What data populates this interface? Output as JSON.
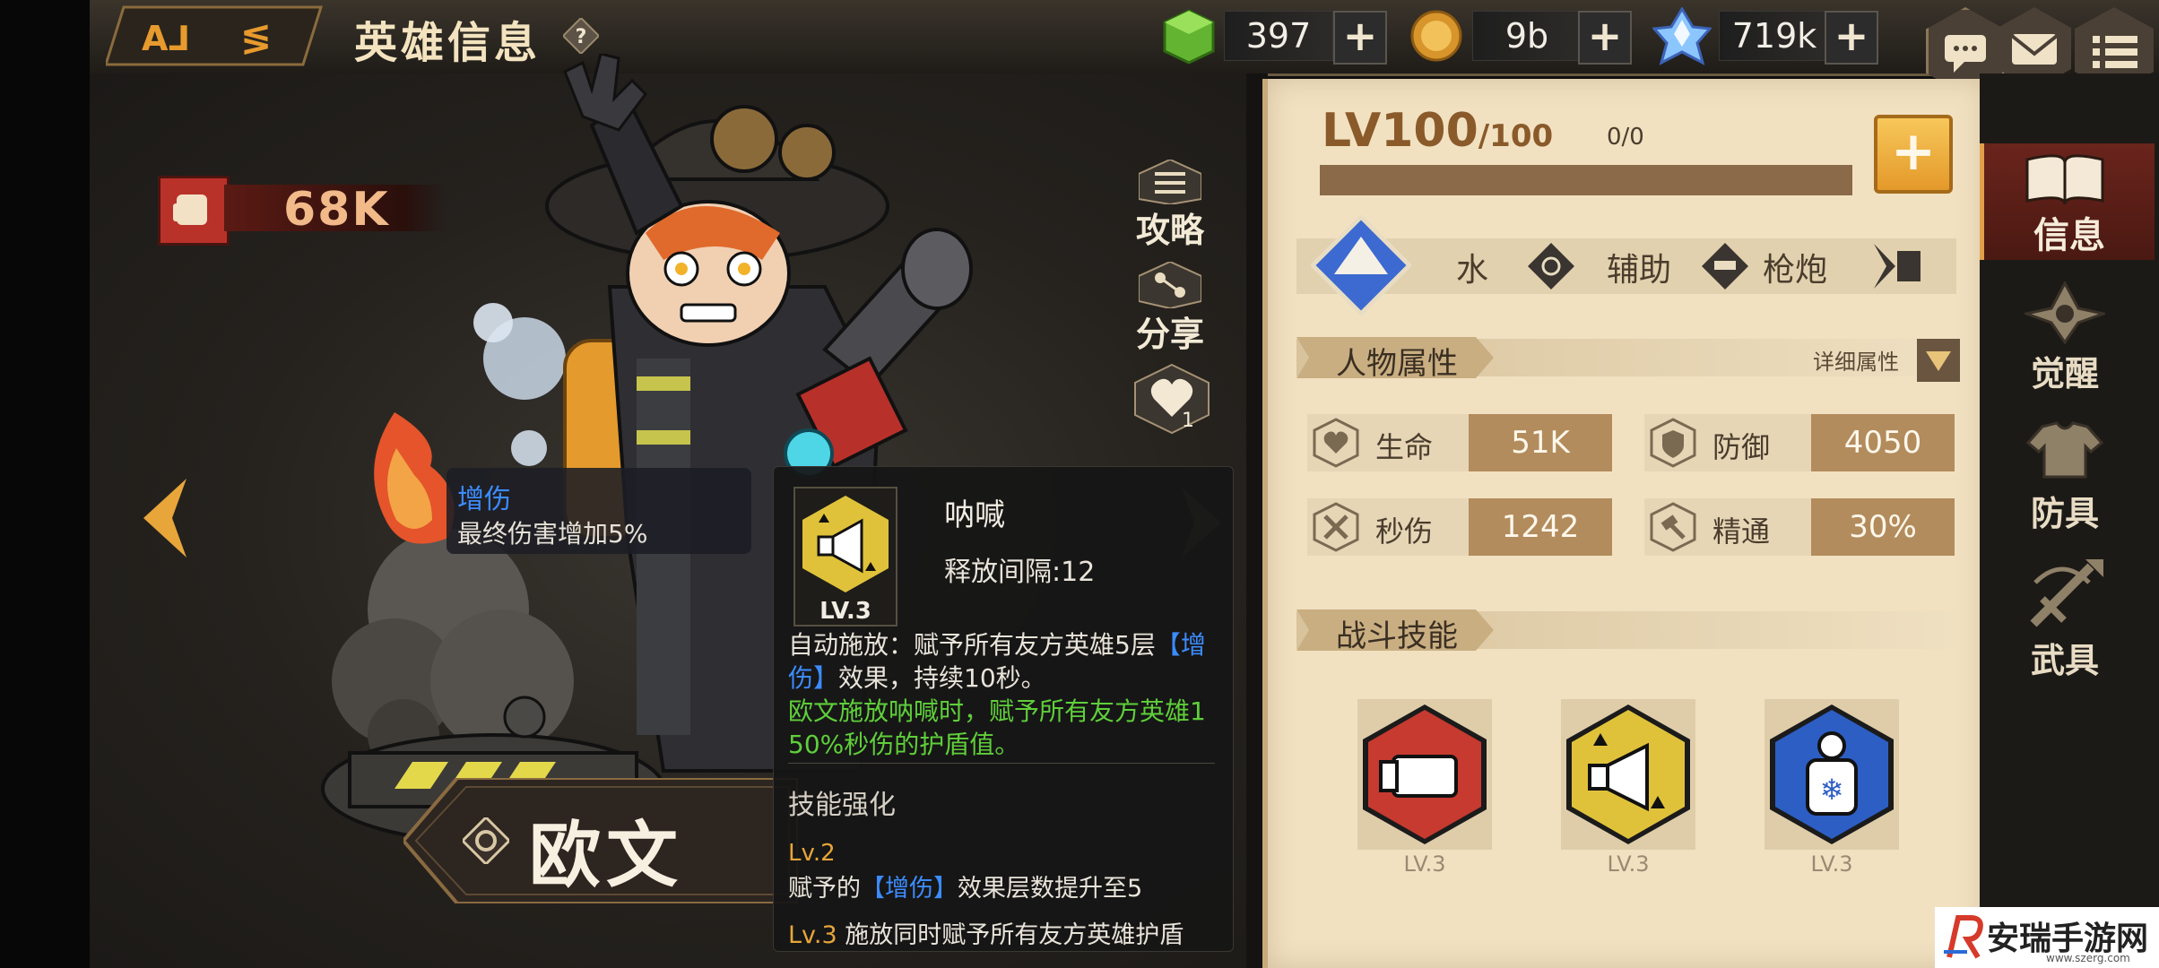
{
  "header": {
    "title": "英雄信息",
    "help_icon": "question-icon",
    "resources": [
      {
        "icon": "green-gem-icon",
        "value": "397"
      },
      {
        "icon": "gold-coin-icon",
        "value": "9b"
      },
      {
        "icon": "crystal-icon",
        "value": "719k"
      }
    ],
    "buttons": [
      "chat-icon",
      "mail-icon",
      "menu-icon"
    ]
  },
  "hero": {
    "power": "68K",
    "name": "欧文",
    "side_buttons": [
      {
        "label": "攻略",
        "icon": "guide-book-icon"
      },
      {
        "label": "分享",
        "icon": "share-icon"
      },
      {
        "label": "",
        "icon": "heart-icon",
        "count": "1"
      }
    ]
  },
  "buff_tooltip": {
    "title": "增伤",
    "desc": "最终伤害增加5%"
  },
  "skill_popup": {
    "name": "呐喊",
    "interval": "释放间隔:12",
    "level": "LV.3",
    "desc_white_1": "自动施放：赋予所有友方英雄5层",
    "desc_blue_1": "【增伤】",
    "desc_white_2": "效果，持续10秒。",
    "desc_green": "欧文施放呐喊时，赋予所有友方英雄150%秒伤的护盾值。",
    "enhance_title": "技能强化",
    "lv2_label": "Lv.2",
    "lv2_prefix": "赋予的",
    "lv2_blue": "【增伤】",
    "lv2_suffix": "效果层数提升至5",
    "lv3_label": "Lv.3",
    "lv3_text": "施放同时赋予所有友方英雄护盾"
  },
  "info_panel": {
    "level": "LV100",
    "level_max": "/100",
    "exp": "0/0",
    "exp_fraction": 0,
    "tags": [
      "水",
      "辅助",
      "枪炮"
    ],
    "attr_title": "人物属性",
    "attr_detail": "详细属性",
    "stats": [
      {
        "label": "生命",
        "value": "51K",
        "icon": "heart-shield-icon"
      },
      {
        "label": "防御",
        "value": "4050",
        "icon": "shield-icon"
      },
      {
        "label": "秒伤",
        "value": "1242",
        "icon": "swords-icon"
      },
      {
        "label": "精通",
        "value": "30%",
        "icon": "hammer-icon"
      }
    ],
    "skill_title": "战斗技能",
    "skills": [
      {
        "icon": "punch-skill-icon",
        "level": "LV.3"
      },
      {
        "icon": "megaphone-skill-icon",
        "level": "LV.3"
      },
      {
        "icon": "frost-flask-skill-icon",
        "level": "LV.3"
      }
    ]
  },
  "right_tabs": [
    {
      "label": "信息",
      "icon": "book-icon"
    },
    {
      "label": "觉醒",
      "icon": "awaken-icon"
    },
    {
      "label": "防具",
      "icon": "armor-icon"
    },
    {
      "label": "武具",
      "icon": "weapon-icon"
    }
  ],
  "watermark": {
    "text": "安瑞手游网",
    "url": "www.szerg.com"
  },
  "colors": {
    "panel": "#f1e1c1",
    "accent_orange": "#f0a63a",
    "blue_text": "#3c8cff",
    "green_text": "#5fcf3a"
  }
}
